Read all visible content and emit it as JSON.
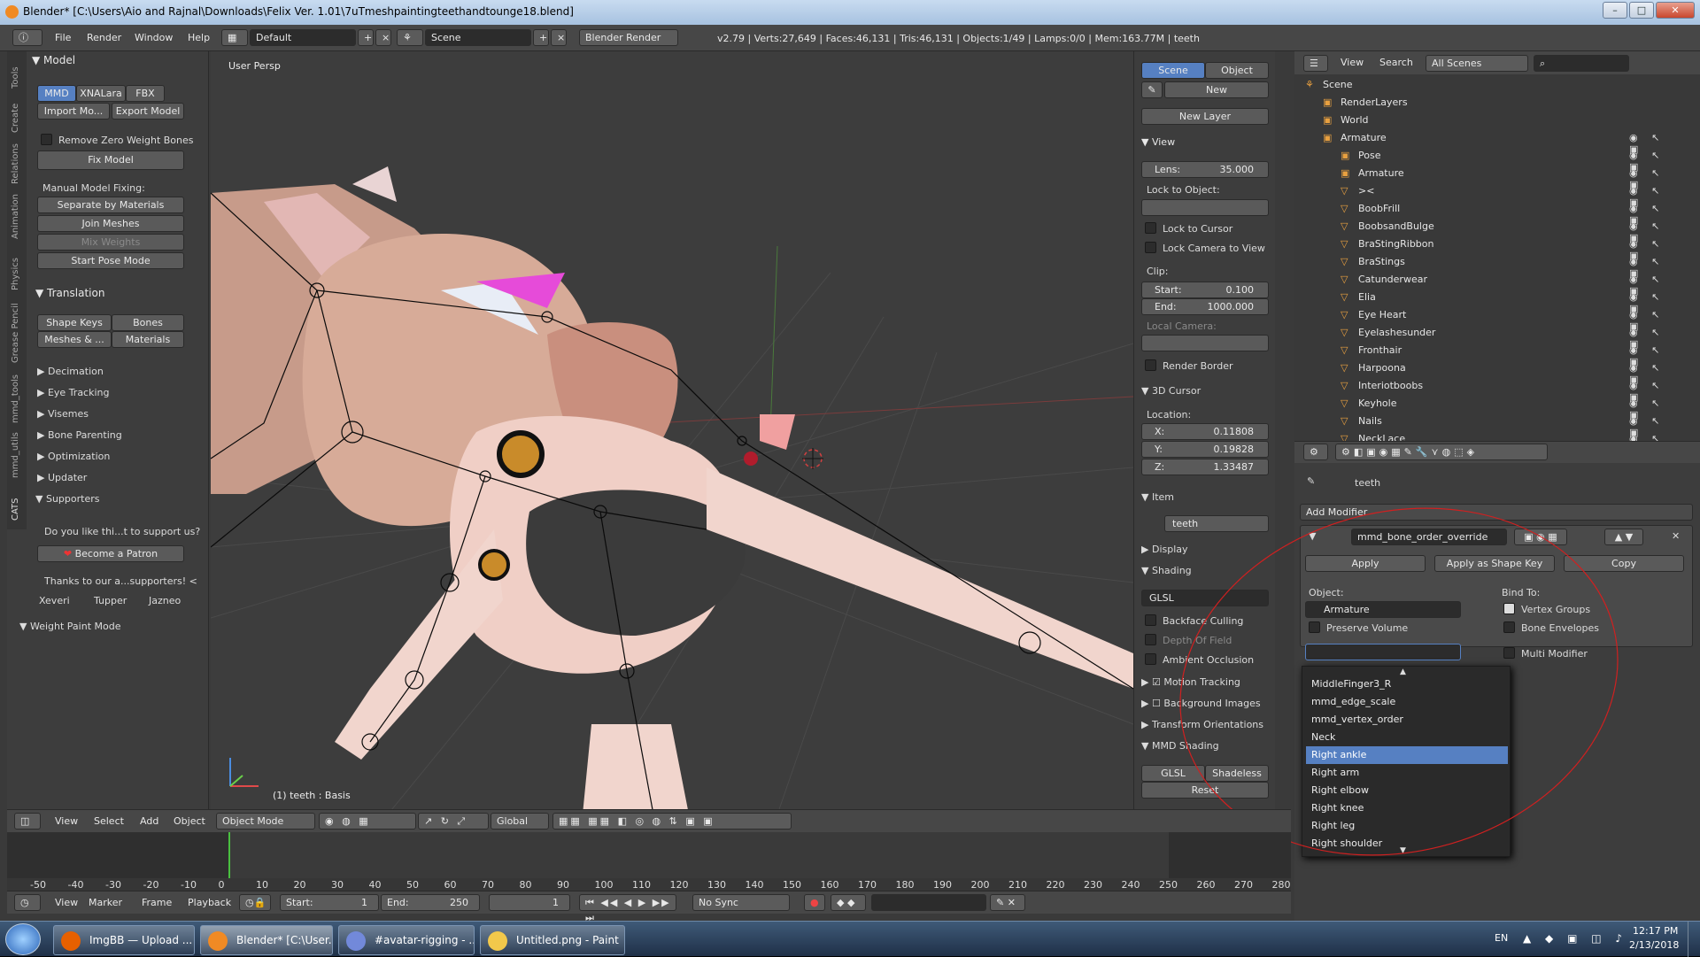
{
  "window": {
    "title": "Blender* [C:\\Users\\Aio and Rajnal\\Downloads\\Felix Ver. 1.01\\7uTmeshpaintingteethandtounge18.blend]",
    "minimize": "–",
    "maximize": "□",
    "close": "✕"
  },
  "header": {
    "menus": [
      "File",
      "Render",
      "Window",
      "Help"
    ],
    "layout": "Default",
    "scene": "Scene",
    "engine": "Blender Render",
    "stats": "v2.79 | Verts:27,649 | Faces:46,131 | Tris:46,131 | Objects:1/49 | Lamps:0/0 | Mem:163.77M | teeth"
  },
  "tools": {
    "vtabs": [
      "Tools",
      "Create",
      "Relations",
      "Animation",
      "Physics",
      "Grease Pencil",
      "mmd_tools",
      "mmd_utils",
      "CATS"
    ],
    "model_title": "Model",
    "tabs": [
      "MMD",
      "XNALara",
      "FBX"
    ],
    "import": "Import Mo...",
    "export": "Export Model",
    "remove_zero": "Remove Zero Weight Bones",
    "fix_model": "Fix Model",
    "manual_fixing": "Manual Model Fixing:",
    "separate": "Separate by Materials",
    "join": "Join Meshes",
    "mix": "Mix Weights",
    "start_pose": "Start Pose Mode",
    "translation_title": "Translation",
    "shape_keys": "Shape Keys",
    "bones": "Bones",
    "meshes": "Meshes & ...",
    "materials": "Materials",
    "sections": [
      "Decimation",
      "Eye Tracking",
      "Visemes",
      "Bone Parenting",
      "Optimization",
      "Updater"
    ],
    "supporters_title": "Supporters",
    "support_q": "Do you like thi...t to support us?",
    "patron": "Become a Patron",
    "thanks": "Thanks to our a...supporters! <",
    "supporters": [
      "Xeveri",
      "Tupper",
      "Jazneo"
    ],
    "weight_paint": "Weight Paint Mode"
  },
  "viewport": {
    "view_name": "User Persp",
    "object_label": "(1) teeth : Basis"
  },
  "npanel": {
    "scene_tab": "Scene",
    "object_tab": "Object",
    "new": "New",
    "new_layer": "New Layer",
    "view_title": "View",
    "lens_label": "Lens:",
    "lens_value": "35.000",
    "lock_obj": "Lock to Object:",
    "lock_cursor": "Lock to Cursor",
    "lock_camera": "Lock Camera to View",
    "clip": "Clip:",
    "start_label": "Start:",
    "start_value": "0.100",
    "end_label": "End:",
    "end_value": "1000.000",
    "local_camera": "Local Camera:",
    "render_border": "Render Border",
    "cursor_title": "3D Cursor",
    "location": "Location:",
    "x_label": "X:",
    "x_value": "0.11808",
    "y_label": "Y:",
    "y_value": "0.19828",
    "z_label": "Z:",
    "z_value": "1.33487",
    "item_title": "Item",
    "item_name": "teeth",
    "display_title": "Display",
    "shading_title": "Shading",
    "shading_mode": "GLSL",
    "backface": "Backface Culling",
    "dof": "Depth Of Field",
    "ao": "Ambient Occlusion",
    "motion_tracking": "Motion Tracking",
    "background_images": "Background Images",
    "transform_orientations": "Transform Orientations",
    "mmd_shading": "MMD Shading",
    "glsl": "GLSL",
    "shadeless": "Shadeless",
    "reset": "Reset"
  },
  "outliner": {
    "menus": [
      "View",
      "Search"
    ],
    "filter": "All Scenes",
    "items": [
      {
        "label": "Scene",
        "level": 0
      },
      {
        "label": "RenderLayers",
        "level": 1
      },
      {
        "label": "World",
        "level": 1
      },
      {
        "label": "Armature",
        "level": 1
      },
      {
        "label": "Pose",
        "level": 2
      },
      {
        "label": "Armature",
        "level": 2
      },
      {
        "label": "><",
        "level": 2
      },
      {
        "label": "BoobFrill",
        "level": 2
      },
      {
        "label": "BoobsandBulge",
        "level": 2
      },
      {
        "label": "BraStingRibbon",
        "level": 2
      },
      {
        "label": "BraStings",
        "level": 2
      },
      {
        "label": "Catunderwear",
        "level": 2
      },
      {
        "label": "Elia",
        "level": 2
      },
      {
        "label": "Eye Heart",
        "level": 2
      },
      {
        "label": "Eyelashesunder",
        "level": 2
      },
      {
        "label": "Fronthair",
        "level": 2
      },
      {
        "label": "Harpoona",
        "level": 2
      },
      {
        "label": "Interiotboobs",
        "level": 2
      },
      {
        "label": "Keyhole",
        "level": 2
      },
      {
        "label": "Nails",
        "level": 2
      },
      {
        "label": "NeckLace",
        "level": 2
      }
    ]
  },
  "properties": {
    "object_name": "teeth",
    "add_modifier": "Add Modifier",
    "modifier_name": "mmd_bone_order_override",
    "apply": "Apply",
    "apply_shape": "Apply as Shape Key",
    "copy": "Copy",
    "object_label": "Object:",
    "object_value": "Armature",
    "preserve": "Preserve Volume",
    "bind_to": "Bind To:",
    "vertex_groups": "Vertex Groups",
    "bone_envelopes": "Bone Envelopes",
    "multi_modifier": "Multi Modifier",
    "dropdown": [
      "MiddleFinger3_R",
      "mmd_edge_scale",
      "mmd_vertex_order",
      "Neck",
      "Right ankle",
      "Right arm",
      "Right elbow",
      "Right knee",
      "Right leg",
      "Right shoulder"
    ],
    "dropdown_selected": "Right ankle"
  },
  "viewport_header": {
    "menus": [
      "View",
      "Select",
      "Add",
      "Object"
    ],
    "mode": "Object Mode",
    "orientation": "Global"
  },
  "timeline": {
    "ticks": [
      "-50",
      "-40",
      "-30",
      "-20",
      "-10",
      "0",
      "10",
      "20",
      "30",
      "40",
      "50",
      "60",
      "70",
      "80",
      "90",
      "100",
      "110",
      "120",
      "130",
      "140",
      "150",
      "160",
      "170",
      "180",
      "190",
      "200",
      "210",
      "220",
      "230",
      "240",
      "250",
      "260",
      "270",
      "280"
    ],
    "menus": [
      "View",
      "Marker",
      "Frame",
      "Playback"
    ],
    "start_label": "Start:",
    "start_value": "1",
    "end_label": "End:",
    "end_value": "250",
    "current": "1",
    "sync": "No Sync"
  },
  "taskbar": {
    "items": [
      "ImgBB — Upload ...",
      "Blender* [C:\\User...",
      "#avatar-rigging - ...",
      "Untitled.png - Paint"
    ],
    "lang": "EN",
    "time": "12:17 PM",
    "date": "2/13/2018"
  },
  "colors": {
    "accent": "#5680c2",
    "annotation_circle": "#d02020"
  }
}
